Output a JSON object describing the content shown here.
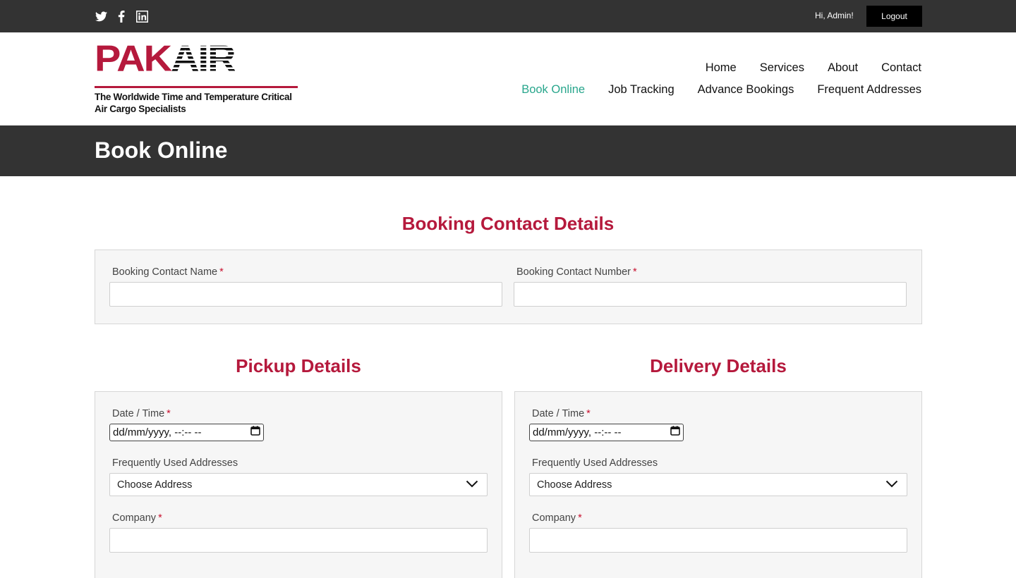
{
  "topbar": {
    "social": [
      "twitter-icon",
      "facebook-icon",
      "linkedin-icon"
    ],
    "greeting": "Hi, Admin!",
    "logout_label": "Logout"
  },
  "logo": {
    "word_part1": "PAK",
    "word_part2": "AIR",
    "tagline_line1": "The Worldwide Time and Temperature Critical",
    "tagline_line2": "Air Cargo Specialists"
  },
  "nav": {
    "primary": [
      "Home",
      "Services",
      "About",
      "Contact"
    ],
    "secondary": [
      "Book Online",
      "Job Tracking",
      "Advance Bookings",
      "Frequent Addresses"
    ],
    "active": "Book Online"
  },
  "page": {
    "title": "Book Online"
  },
  "booking_contact": {
    "heading": "Booking Contact Details",
    "name_label": "Booking Contact Name",
    "number_label": "Booking Contact Number",
    "required_mark": "*"
  },
  "pickup": {
    "heading": "Pickup Details",
    "datetime_label": "Date / Time",
    "datetime_placeholder": "dd/mm/yyyy, --:-- --",
    "addresses_label": "Frequently Used Addresses",
    "address_selected": "Choose Address",
    "company_label": "Company"
  },
  "delivery": {
    "heading": "Delivery Details",
    "datetime_label": "Date / Time",
    "datetime_placeholder": "dd/mm/yyyy, --:-- --",
    "addresses_label": "Frequently Used Addresses",
    "address_selected": "Choose Address",
    "company_label": "Company"
  },
  "colors": {
    "brand_red": "#b5193c",
    "active_nav": "#28a68c",
    "dark_bar": "#333333"
  }
}
